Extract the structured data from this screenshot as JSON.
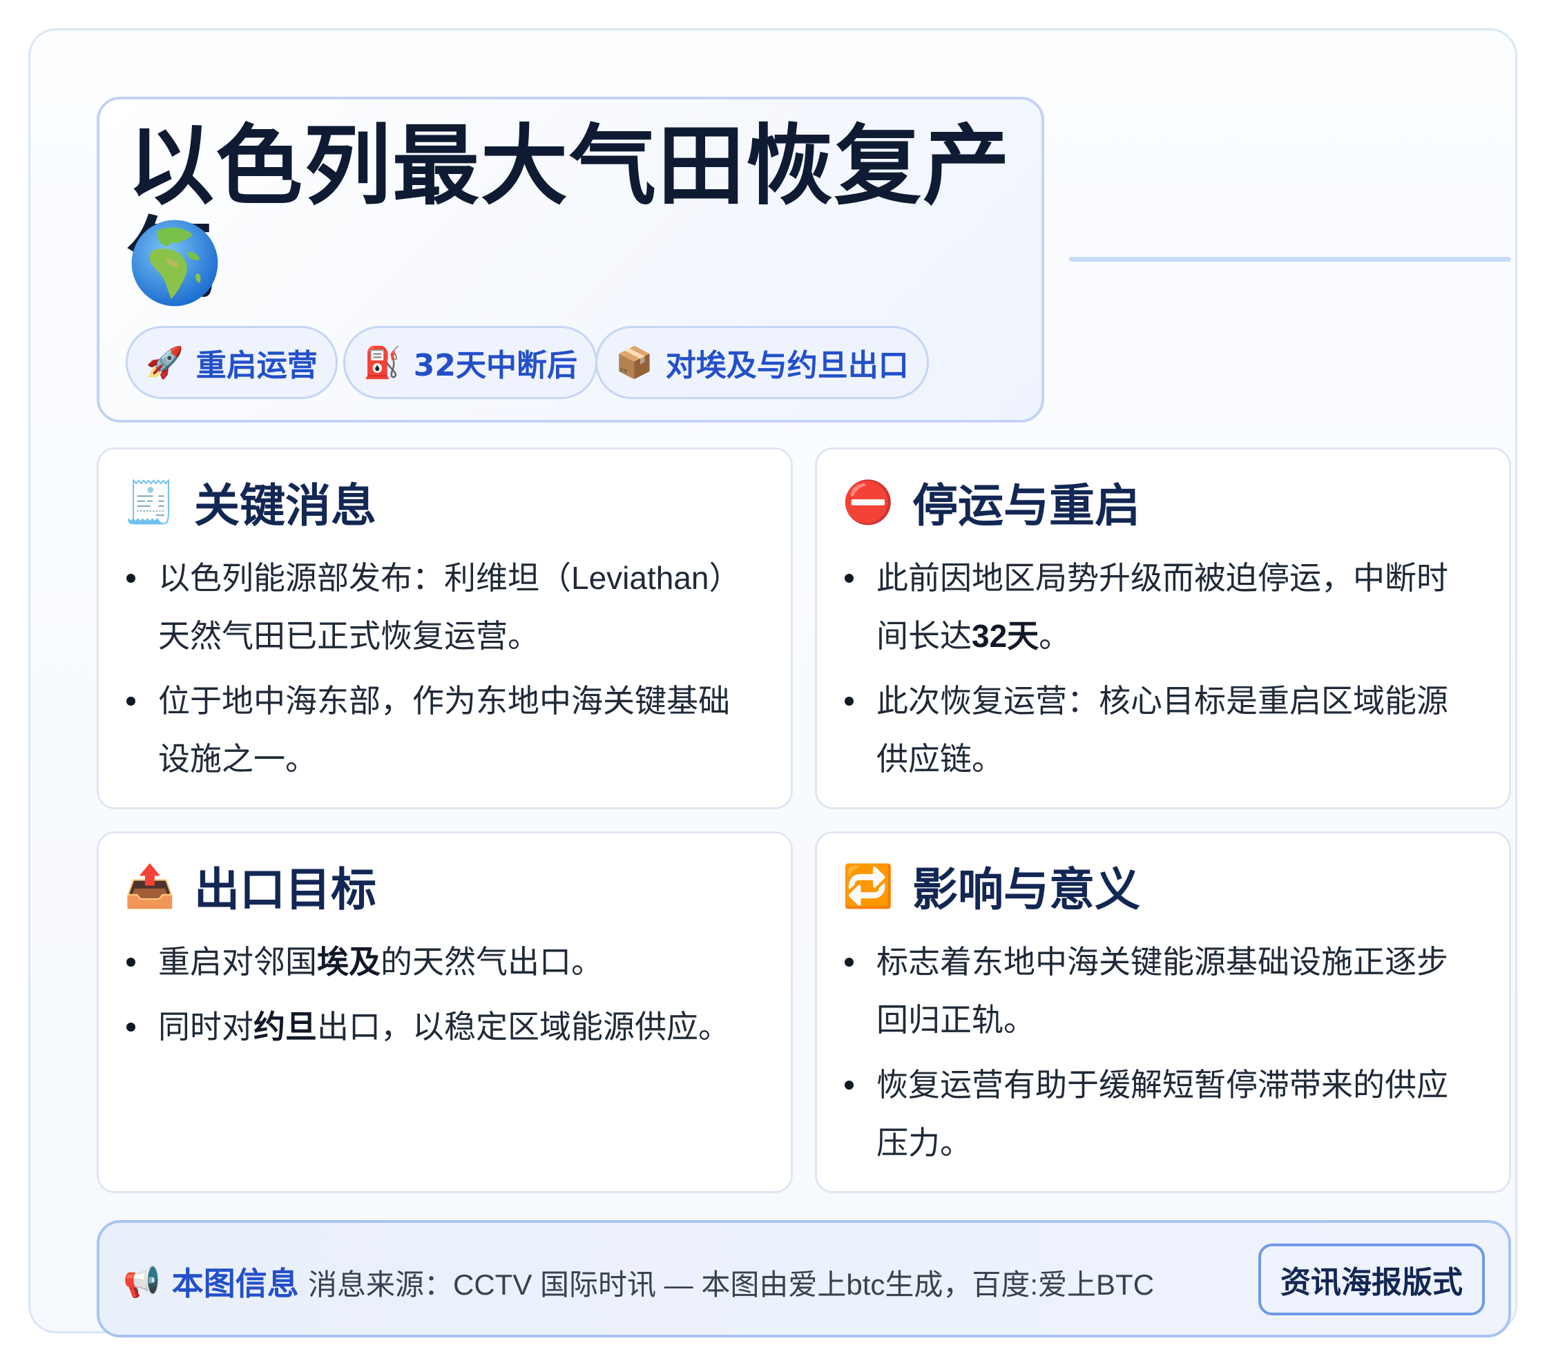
{
  "title": {
    "text": "以色列最大气田恢复产气",
    "emoji": "🌍"
  },
  "tags": [
    {
      "icon": "🚀",
      "label": "重启运营"
    },
    {
      "icon": "⛽",
      "label": "32天中断后"
    },
    {
      "icon": "📦",
      "label": "对埃及与约旦出口"
    }
  ],
  "cards": [
    {
      "icon": "🧾",
      "title": "关键消息",
      "items": [
        [
          "以色列能源部发布：利维坦（Leviathan）天然气田已正式恢复运营。"
        ],
        [
          "位于地中海东部，作为东地中海关键基础设施之一。"
        ]
      ]
    },
    {
      "icon": "⛔",
      "title": "停运与重启",
      "items": [
        [
          "此前因地区局势升级而被迫停运，中断时间长达",
          "32天",
          "。"
        ],
        [
          "此次恢复运营：核心目标是重启区域能源供应链。"
        ]
      ]
    },
    {
      "icon": "📤",
      "title": "出口目标",
      "items": [
        [
          "重启对邻国",
          "埃及",
          "的天然气出口。"
        ],
        [
          "同时对",
          "约旦",
          "出口，以稳定区域能源供应。"
        ]
      ]
    },
    {
      "icon": "🔁",
      "title": "影响与意义",
      "items": [
        [
          "标志着东地中海关键能源基础设施正逐步回归正轨。"
        ],
        [
          "恢复运营有助于缓解短暂停滞带来的供应压力。"
        ]
      ]
    }
  ],
  "footer": {
    "icon": "📢",
    "label": "本图信息",
    "text": "消息来源：CCTV 国际时讯 — 本图由爱上btc生成，百度:爱上BTC",
    "button": "资讯海报版式"
  }
}
